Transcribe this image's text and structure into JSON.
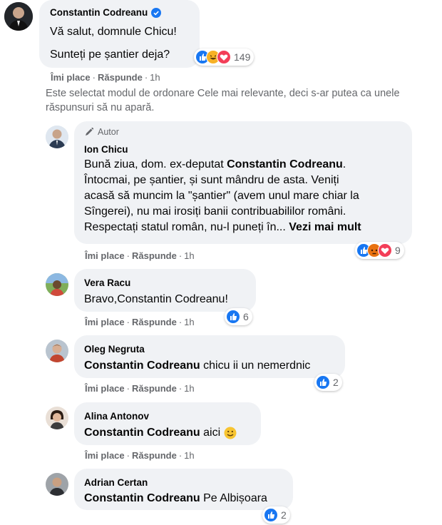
{
  "main_comment": {
    "author": "Constantin Codreanu",
    "line1": "Vă salut, domnule Chicu!",
    "line2": "Sunteți pe șantier deja?",
    "reaction_count": "149",
    "like_label": "Îmi place",
    "reply_label": "Răspunde",
    "time": "1h"
  },
  "sort_notice": {
    "line1": "Este selectat modul de ordonare Cele mai relevante, deci s-ar putea ca unele",
    "line2": "răspunsuri să nu apară."
  },
  "replies": [
    {
      "badge": "Autor",
      "author": "Ion Chicu",
      "text_before": "Bună ziua, dom. ex-deputat ",
      "mention": "Constantin Codreanu",
      "text_after": ".",
      "lines": [
        "Întocmai, pe șantier, și sunt mândru de asta. Veniți",
        "acasă să muncim la \"șantier\" (avem unul mare chiar la",
        "Sîngerei), nu mai irosiți banii contribuabililor români.",
        "Respectați statul român, nu-l puneți în..."
      ],
      "see_more": "Vezi mai mult",
      "reaction_count": "9",
      "like_label": "Îmi place",
      "reply_label": "Răspunde",
      "time": "1h"
    },
    {
      "author": "Vera Racu",
      "text": "Bravo,Constantin Codreanu!",
      "reaction_count": "6",
      "like_label": "Îmi place",
      "reply_label": "Răspunde",
      "time": "1h"
    },
    {
      "author": "Oleg Negruta",
      "mention": "Constantin Codreanu",
      "text": " chicu ii un nemerdnic",
      "reaction_count": "2",
      "like_label": "Îmi place",
      "reply_label": "Răspunde",
      "time": "1h"
    },
    {
      "author": "Alina Antonov",
      "mention": "Constantin Codreanu",
      "text": " aici",
      "reaction_count": "",
      "like_label": "Îmi place",
      "reply_label": "Răspunde",
      "time": "1h"
    },
    {
      "author": "Adrian Certan",
      "mention": "Constantin Codreanu",
      "text": " Pe Albișoara",
      "reaction_count": "2"
    }
  ],
  "colors": {
    "bubble": "#f0f2f5",
    "like_blue": "#1877f2",
    "muted": "#65676b"
  }
}
